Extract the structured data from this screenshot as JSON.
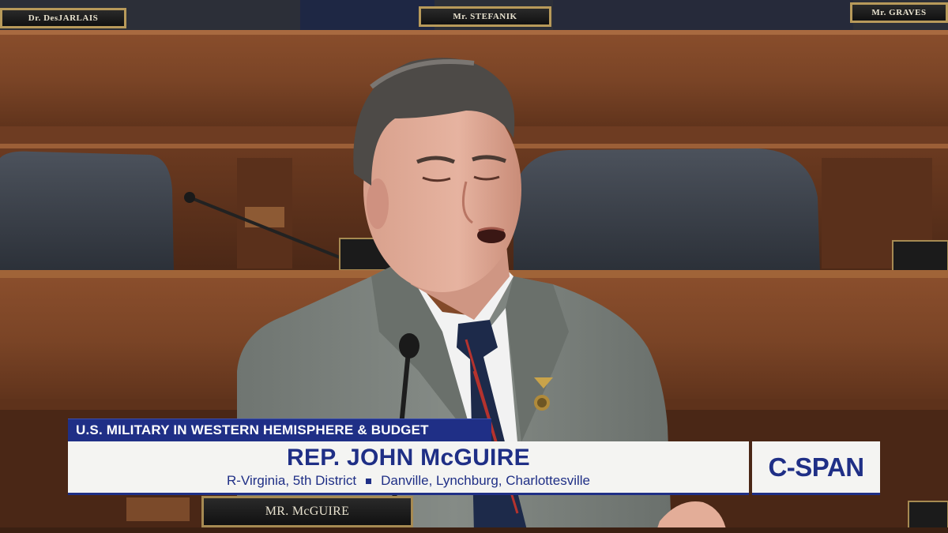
{
  "nameplates": {
    "top_left": "Dr. DesJARLAIS",
    "top_center": "Mr. STEFANIK",
    "top_right": "Mr. GRAVES",
    "speaker": "MR. McGUIRE"
  },
  "lower_third": {
    "topic": "U.S. MILITARY IN WESTERN HEMISPHERE & BUDGET",
    "name": "REP. JOHN McGUIRE",
    "party_district": "R-Virginia, 5th District",
    "localities": "Danville, Lynchburg, Charlottesville"
  },
  "network_logo": "C-SPAN",
  "colors": {
    "brand_blue": "#1f2f86",
    "panel_white": "#f4f4f2",
    "wood": "#7a4426"
  }
}
